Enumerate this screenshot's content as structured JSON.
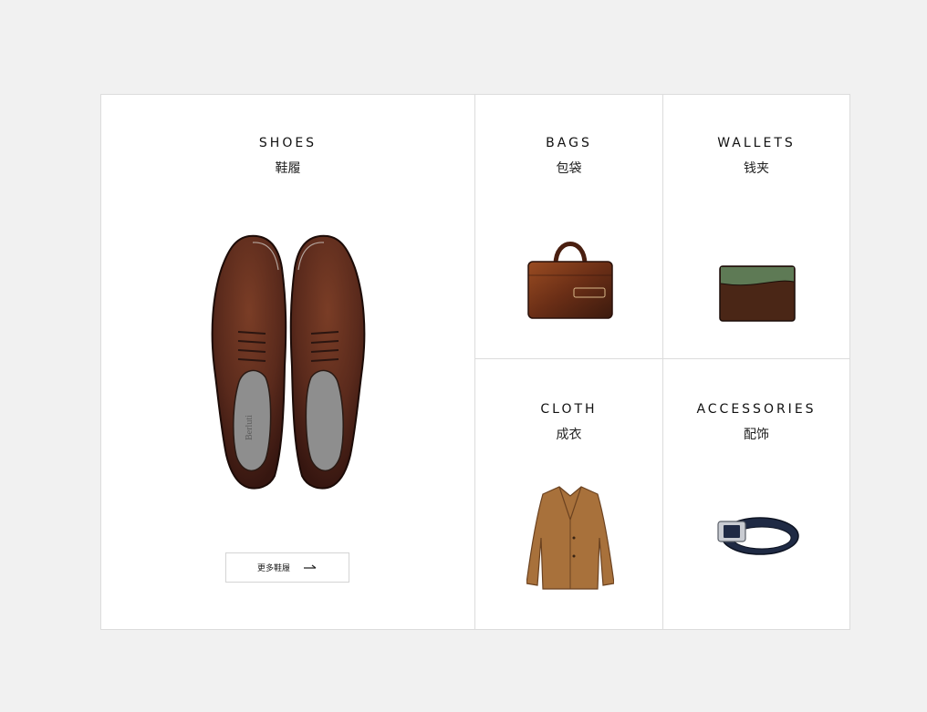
{
  "categories": {
    "shoes": {
      "title_en": "SHOES",
      "title_cn": "鞋履",
      "more_label": "更多鞋履",
      "brand_mark": "Berluti"
    },
    "bags": {
      "title_en": "BAGS",
      "title_cn": "包袋"
    },
    "wallets": {
      "title_en": "WALLETS",
      "title_cn": "钱夹"
    },
    "cloth": {
      "title_en": "CLOTH",
      "title_cn": "成衣"
    },
    "accessories": {
      "title_en": "ACCESSORIES",
      "title_cn": "配饰"
    }
  },
  "icons": {
    "more_arrow": "arrow-right-icon"
  },
  "colors": {
    "page_bg": "#f1f1f1",
    "panel_bg": "#ffffff",
    "divider": "#dcdcdc",
    "leather_brown": "#5a2a1c",
    "coat_camel": "#a8713b",
    "wallet_green": "#5e7a55",
    "belt_navy": "#1f2a44"
  }
}
